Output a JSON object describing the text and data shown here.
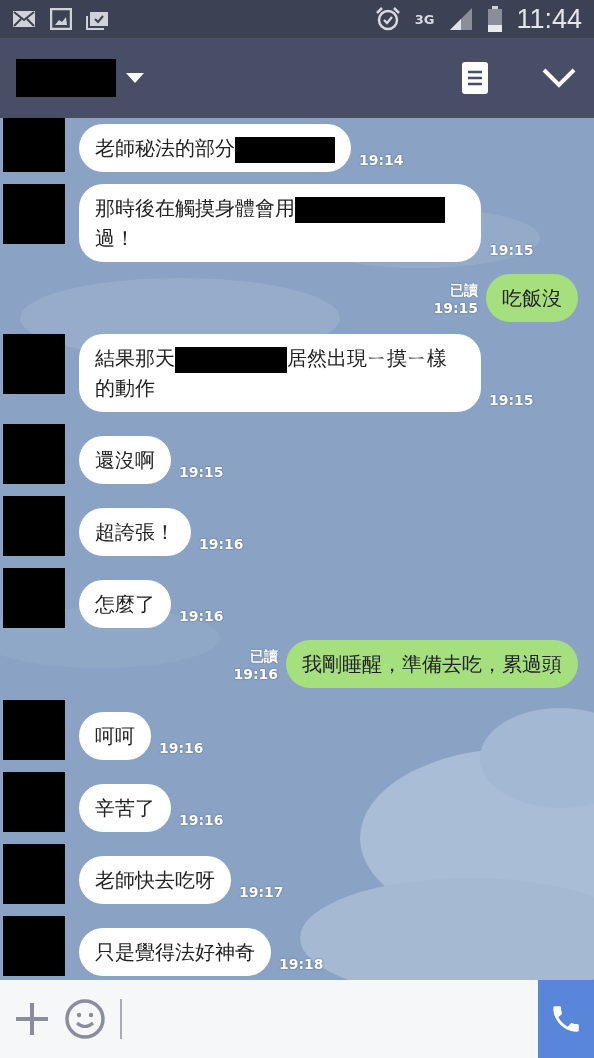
{
  "status_bar": {
    "network": "3G",
    "time": "11:44"
  },
  "header": {
    "title_redacted": true
  },
  "messages": [
    {
      "kind": "in",
      "parts": [
        {
          "kind": "text",
          "text": "老師秘法的部分"
        },
        {
          "kind": "redaction"
        }
      ],
      "time": "19:14"
    },
    {
      "kind": "in",
      "parts": [
        {
          "kind": "text",
          "text": "那時後在觸摸身體會用"
        },
        {
          "kind": "redaction"
        },
        {
          "kind": "text",
          "text": "過！"
        }
      ],
      "time": "19:15"
    },
    {
      "kind": "out",
      "parts": [
        {
          "kind": "text",
          "text": "吃飯沒"
        }
      ],
      "read_label": "已讀",
      "time": "19:15"
    },
    {
      "kind": "in",
      "parts": [
        {
          "kind": "text",
          "text": "結果那天"
        },
        {
          "kind": "redaction"
        },
        {
          "kind": "text",
          "text": "居然出現ㄧ摸ㄧ樣的動作"
        }
      ],
      "time": "19:15"
    },
    {
      "kind": "in",
      "parts": [
        {
          "kind": "text",
          "text": "還沒啊"
        }
      ],
      "time": "19:15"
    },
    {
      "kind": "in",
      "parts": [
        {
          "kind": "text",
          "text": "超誇張！"
        }
      ],
      "time": "19:16"
    },
    {
      "kind": "in",
      "parts": [
        {
          "kind": "text",
          "text": "怎麼了"
        }
      ],
      "time": "19:16"
    },
    {
      "kind": "out",
      "parts": [
        {
          "kind": "text",
          "text": "我剛睡醒，準備去吃，累過頭"
        }
      ],
      "read_label": "已讀",
      "time": "19:16"
    },
    {
      "kind": "in",
      "parts": [
        {
          "kind": "text",
          "text": "呵呵"
        }
      ],
      "time": "19:16"
    },
    {
      "kind": "in",
      "parts": [
        {
          "kind": "text",
          "text": "辛苦了"
        }
      ],
      "time": "19:16"
    },
    {
      "kind": "in",
      "parts": [
        {
          "kind": "text",
          "text": "老師快去吃呀"
        }
      ],
      "time": "19:17"
    },
    {
      "kind": "in",
      "parts": [
        {
          "kind": "text",
          "text": "只是覺得法好神奇"
        }
      ],
      "time": "19:18"
    }
  ]
}
